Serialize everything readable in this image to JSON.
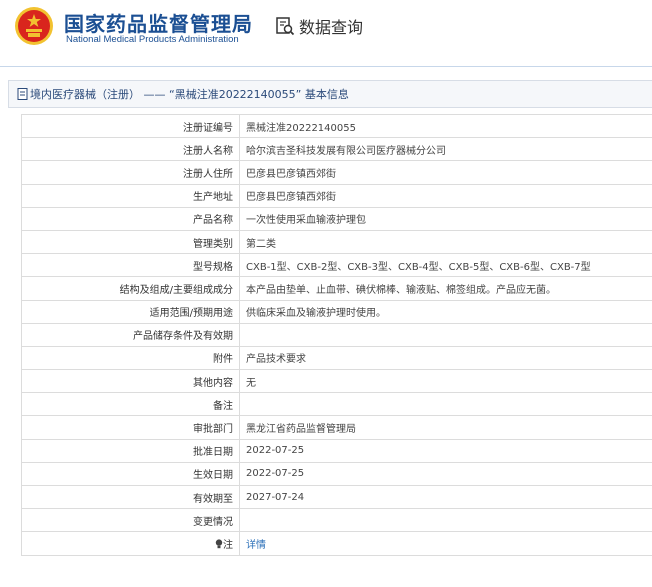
{
  "header": {
    "org_name_cn": "国家药品监督管理局",
    "org_name_en": "National Medical Products Administration",
    "query_label": "数据查询",
    "emblem_icon": "national-emblem-icon",
    "query_icon": "data-search-icon"
  },
  "title_bar": {
    "text": "境内医疗器械（注册） —— “黑械注准20222140055” 基本信息"
  },
  "rows": [
    {
      "label": "注册证编号",
      "value": "黑械注准20222140055"
    },
    {
      "label": "注册人名称",
      "value": "哈尔滨吉圣科技发展有限公司医疗器械分公司"
    },
    {
      "label": "注册人住所",
      "value": "巴彦县巴彦镇西郊街"
    },
    {
      "label": "生产地址",
      "value": "巴彦县巴彦镇西郊街"
    },
    {
      "label": "产品名称",
      "value": "一次性使用采血输液护理包"
    },
    {
      "label": "管理类别",
      "value": "第二类"
    },
    {
      "label": "型号规格",
      "value": "CXB-1型、CXB-2型、CXB-3型、CXB-4型、CXB-5型、CXB-6型、CXB-7型"
    },
    {
      "label": "结构及组成/主要组成成分",
      "value": "本产品由垫单、止血带、碘伏棉棒、输液贴、棉签组成。产品应无菌。"
    },
    {
      "label": "适用范围/预期用途",
      "value": "供临床采血及输液护理时使用。"
    },
    {
      "label": "产品储存条件及有效期",
      "value": ""
    },
    {
      "label": "附件",
      "value": "产品技术要求"
    },
    {
      "label": "其他内容",
      "value": "无"
    },
    {
      "label": "备注",
      "value": ""
    },
    {
      "label": "审批部门",
      "value": "黑龙江省药品监督管理局"
    },
    {
      "label": "批准日期",
      "value": "2022-07-25"
    },
    {
      "label": "生效日期",
      "value": "2022-07-25"
    },
    {
      "label": "有效期至",
      "value": "2027-07-24"
    },
    {
      "label": "变更情况",
      "value": ""
    }
  ],
  "note_row": {
    "label": "注",
    "icon": "lightbulb-icon",
    "link_text": "详情"
  },
  "colors": {
    "brand_blue": "#1b4f93",
    "emblem_red": "#d9251d",
    "emblem_gold": "#f2c230",
    "link": "#2a6fb8"
  }
}
